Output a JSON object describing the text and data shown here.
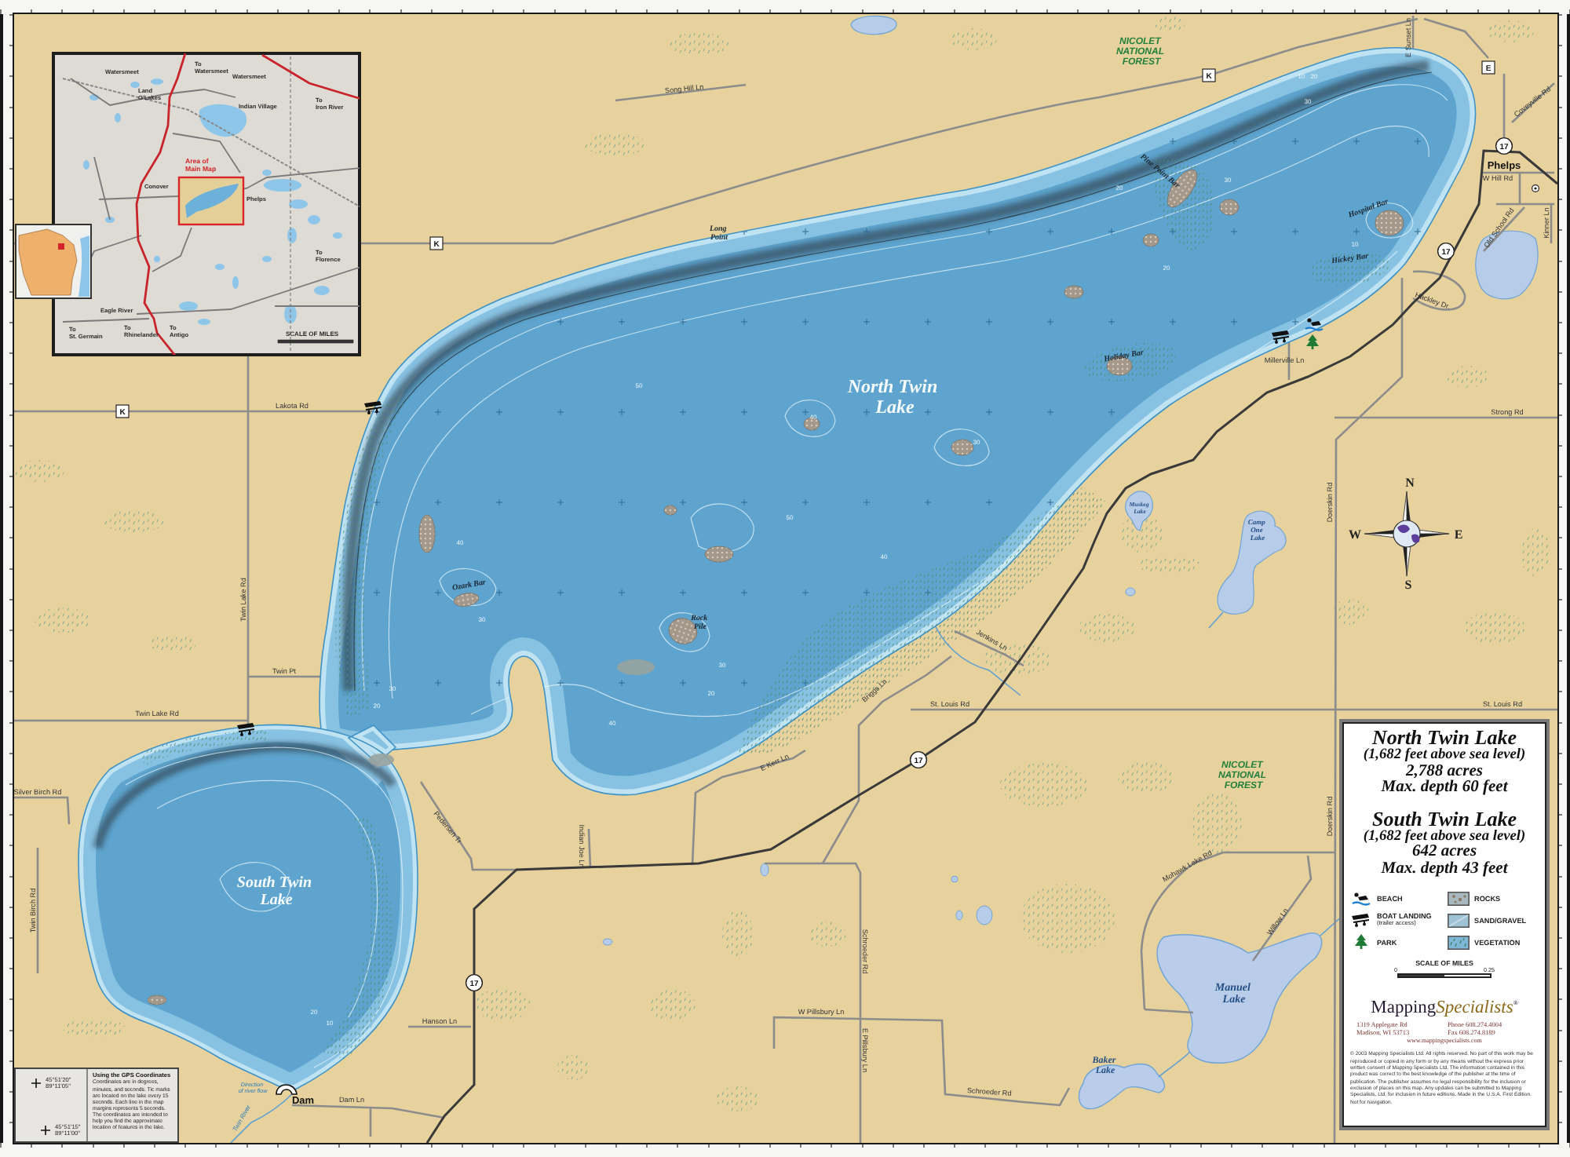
{
  "inset_map": {
    "places": [
      {
        "lines": [
          "Watersmeet"
        ]
      },
      {
        "lines": [
          "To",
          "Watersmeet"
        ]
      },
      {
        "lines": [
          "Watersmeet"
        ]
      },
      {
        "lines": [
          "Land",
          "O'Lakes"
        ]
      },
      {
        "lines": [
          "Indian Village"
        ]
      },
      {
        "lines": [
          "To",
          "Iron River"
        ]
      },
      {
        "lines": [
          "Conover"
        ]
      },
      {
        "lines": [
          "Phelps"
        ]
      },
      {
        "lines": [
          "To",
          "Florence"
        ]
      },
      {
        "lines": [
          "Eagle River"
        ]
      },
      {
        "lines": [
          "To",
          "St. Germain"
        ]
      },
      {
        "lines": [
          "To",
          "Rhinelander"
        ]
      },
      {
        "lines": [
          "To",
          "Antigo"
        ]
      }
    ],
    "area_label": [
      "Area of",
      "Main Map"
    ],
    "scale_label": "SCALE OF MILES"
  },
  "map": {
    "lake_labels": [
      {
        "lines": [
          "North Twin",
          "Lake"
        ]
      },
      {
        "lines": [
          "Muskeg",
          "Lake"
        ]
      },
      {
        "lines": [
          "Camp",
          "One",
          "Lake"
        ]
      },
      {
        "lines": [
          "South Twin",
          "Lake"
        ]
      },
      {
        "lines": [
          "Manuel",
          "Lake"
        ]
      },
      {
        "lines": [
          "Baker",
          "Lake"
        ]
      }
    ],
    "forest_labels": [
      {
        "lines": [
          "NICOLET",
          "NATIONAL",
          "FOREST"
        ]
      },
      {
        "lines": [
          "NICOLET",
          "NATIONAL",
          "FOREST"
        ]
      }
    ],
    "place_labels": [
      "Phelps",
      "Dam"
    ],
    "feature_labels": [
      {
        "lines": [
          "Long",
          "Point"
        ]
      },
      {
        "lines": [
          "Pine Point Bar"
        ]
      },
      {
        "lines": [
          "Hospital Bar"
        ]
      },
      {
        "lines": [
          "Hickey Bar"
        ]
      },
      {
        "lines": [
          "Holiday Bar"
        ]
      },
      {
        "lines": [
          "Ozark Bar"
        ]
      },
      {
        "lines": [
          "Rock",
          "Pile"
        ]
      }
    ],
    "river_labels": [
      {
        "lines": [
          "Direction",
          "of river flow"
        ]
      },
      {
        "lines": [
          "Twin River"
        ]
      }
    ],
    "road_labels": [
      "E Sunset Ln",
      "Coveyville Rd",
      "Song Hill Ln",
      "W Hill Rd",
      "Old School Rd",
      "Kinner Ln",
      "Hackley Dr.",
      "Millerville Ln",
      "Lakota Rd",
      "Strong Rd",
      "Doerskin Rd",
      "Twin Lake Rd",
      "Jenkins Ln",
      "Twin Pt",
      "Briggs Ln",
      "St. Louis Rd",
      "St. Louis Rd",
      "Twin Lake Rd",
      "E Kerr Ln",
      "Silver Birch Rd",
      "Doerskin Rd",
      "Pedersen Tr",
      "Indian Joe Ln",
      "Mohawk Lake Rd",
      "Twin Birch Rd",
      "Willow Ln",
      "Schroeder Rd",
      "W Pillsbury Ln",
      "Hanson Ln",
      "E Pillsbury Ln",
      "Schroeder Rd",
      "Dam Ln"
    ],
    "route_markers": [
      {
        "kind": "county",
        "label": "K"
      },
      {
        "kind": "county",
        "label": "E"
      },
      {
        "kind": "state",
        "label": "17"
      },
      {
        "kind": "county",
        "label": "K"
      },
      {
        "kind": "state",
        "label": "17"
      },
      {
        "kind": "county",
        "label": "K"
      },
      {
        "kind": "state",
        "label": "17"
      },
      {
        "kind": "state",
        "label": "17"
      }
    ],
    "depth_labels": [
      "10",
      "20",
      "30",
      "20",
      "30",
      "20",
      "10",
      "50",
      "40",
      "30",
      "50",
      "40",
      "30",
      "40",
      "30",
      "20",
      "30",
      "20",
      "40",
      "20",
      "10"
    ]
  },
  "compass": {
    "north": "N",
    "west": "W",
    "east": "E",
    "south": "S"
  },
  "gps_note": {
    "coordinates": [
      {
        "latitude": "45°51'20\"",
        "longitude": "89°11'05\""
      },
      {
        "latitude": "45°51'15\"",
        "longitude": "89°11'00\""
      }
    ],
    "title": "Using the GPS Coordinates",
    "text": "Coordinates are in degrees, minutes, and seconds. Tic marks are located on the lake every 15 seconds. Each line in the map margins represents 5 seconds. The coordinates are intended to help you find the approximate location of features in the lake."
  },
  "info_panel": {
    "lakes": [
      {
        "name": "North Twin Lake",
        "elevation": "(1,682 feet above sea level)",
        "area": "2,788 acres",
        "max_depth": "Max. depth 60 feet"
      },
      {
        "name": "South Twin Lake",
        "elevation": "(1,682 feet above sea level)",
        "area": "642 acres",
        "max_depth": "Max. depth 43 feet"
      }
    ],
    "legend": [
      {
        "kind": "beach",
        "label": "BEACH"
      },
      {
        "kind": "rocks",
        "label": "ROCKS"
      },
      {
        "kind": "boat_landing",
        "label": "BOAT LANDING",
        "note": "(trailer access)"
      },
      {
        "kind": "sand_gravel",
        "label": "SAND/GRAVEL"
      },
      {
        "kind": "park",
        "label": "PARK"
      },
      {
        "kind": "vegetation",
        "label": "VEGETATION"
      }
    ],
    "scale": {
      "title": "SCALE OF MILES",
      "ticks": [
        "0",
        "0.25"
      ]
    },
    "logo": {
      "words": [
        "Mapping",
        "Specialists"
      ],
      "mark": "®"
    },
    "address": [
      "1319 Applegate Rd",
      "Madison, WI 53713"
    ],
    "phone": [
      "Phone 608.274.4004",
      "Fax 608.274.8189"
    ],
    "website": "www.mappingspecialists.com",
    "copyright": "© 2003 Mapping Specialists Ltd. All rights reserved. No part of this work may be reproduced or copied in any form or by any means without the express prior written consent of Mapping Specialists Ltd. The information contained in this product was correct to the best knowledge of the publisher at the time of publication. The publisher assumes no legal responsibility for the inclusion or exclusion of places on this map. Any updates can be submitted to Mapping Specialists, Ltd. for inclusion in future editions. Made in the U.S.A. First Edition. Not for navigation."
  }
}
